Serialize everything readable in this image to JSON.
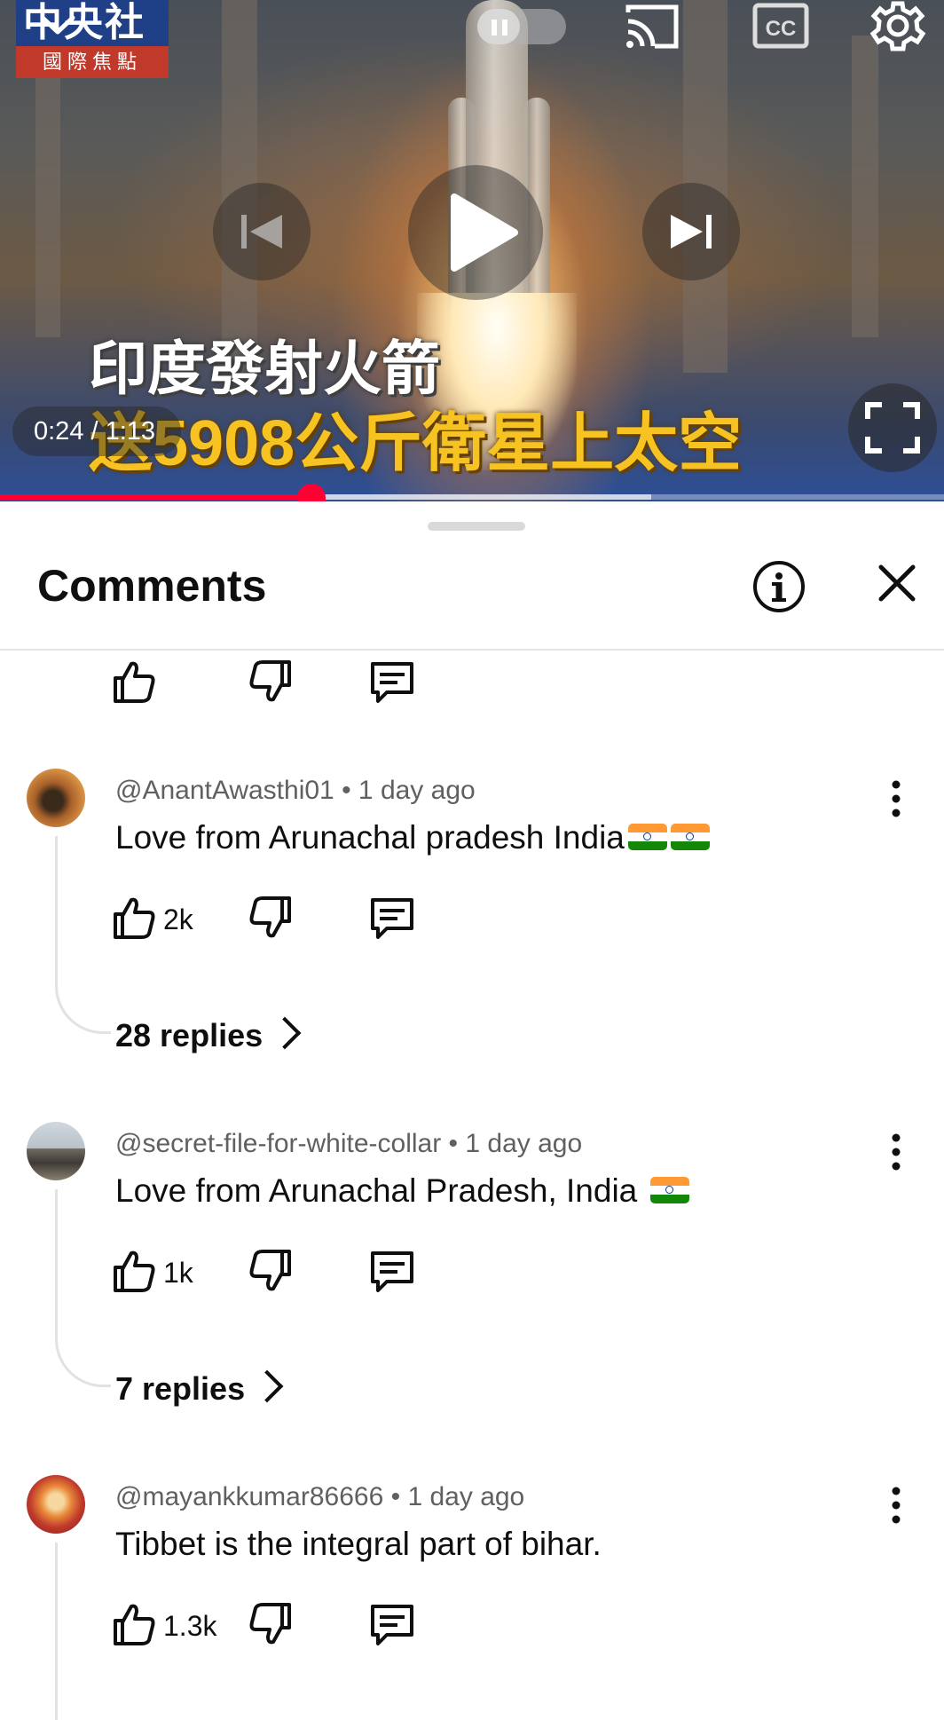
{
  "video": {
    "channel_logo_top": "中央社",
    "channel_logo_bottom": "國際焦點",
    "subtitle_line1": "印度發射火箭",
    "subtitle_line2": "送5908公斤衛星上太空",
    "time_display": "0:24 / 1:13",
    "progress_played_fraction": 0.33,
    "progress_buffered_fraction": 0.69,
    "accent_color": "#ff0033",
    "icons": [
      "chevron-down-icon",
      "pause-icon",
      "cast-icon",
      "cc-icon",
      "gear-icon",
      "previous-icon",
      "play-icon",
      "next-icon",
      "fullscreen-icon"
    ]
  },
  "comments_panel": {
    "title": "Comments",
    "icons": [
      "info-icon",
      "close-icon"
    ]
  },
  "comments": [
    {
      "author": "@AnantAwasthi01",
      "time": "1 day ago",
      "text": "Love from Arunachal pradesh India",
      "flags": 2,
      "likes": "2k",
      "replies": "28 replies"
    },
    {
      "author": "@secret-file-for-white-collar",
      "time": "1 day ago",
      "text": "Love from Arunachal Pradesh, India ",
      "flags": 1,
      "likes": "1k",
      "replies": "7 replies"
    },
    {
      "author": "@mayankkumar86666",
      "time": "1 day ago",
      "text": "Tibbet is the integral part of bihar.",
      "flags": 0,
      "likes": "1.3k"
    }
  ],
  "separator": " • "
}
